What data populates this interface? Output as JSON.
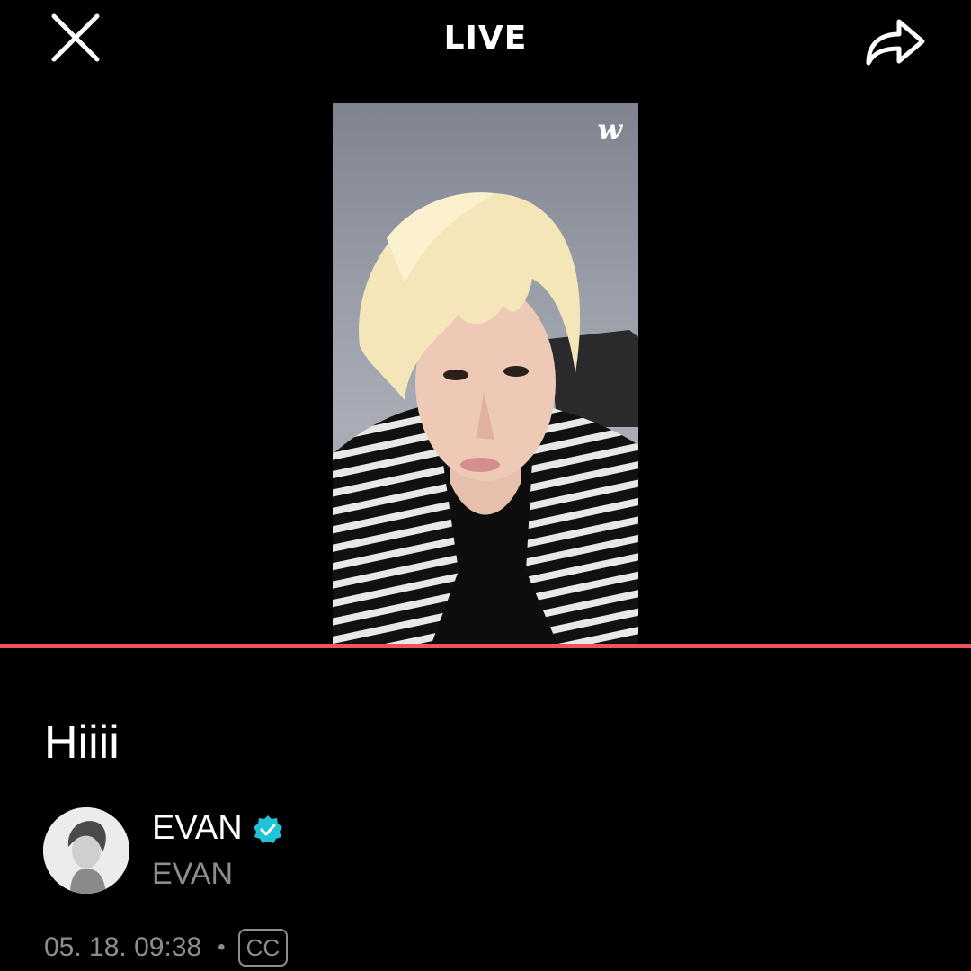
{
  "header": {
    "title": "LIVE",
    "close_icon": "close-icon",
    "share_icon": "share-icon"
  },
  "player": {
    "logo_text": "w",
    "progress_percent": 100,
    "progress_color": "#f2525a"
  },
  "stream": {
    "title": "Hiiii"
  },
  "artist": {
    "name": "EVAN",
    "handle": "EVAN",
    "verified_icon": "verified-badge-icon",
    "verified_color": "#1fc4d6"
  },
  "meta": {
    "date": "05. 18. 09:38",
    "separator": "•",
    "cc_label": "CC"
  }
}
